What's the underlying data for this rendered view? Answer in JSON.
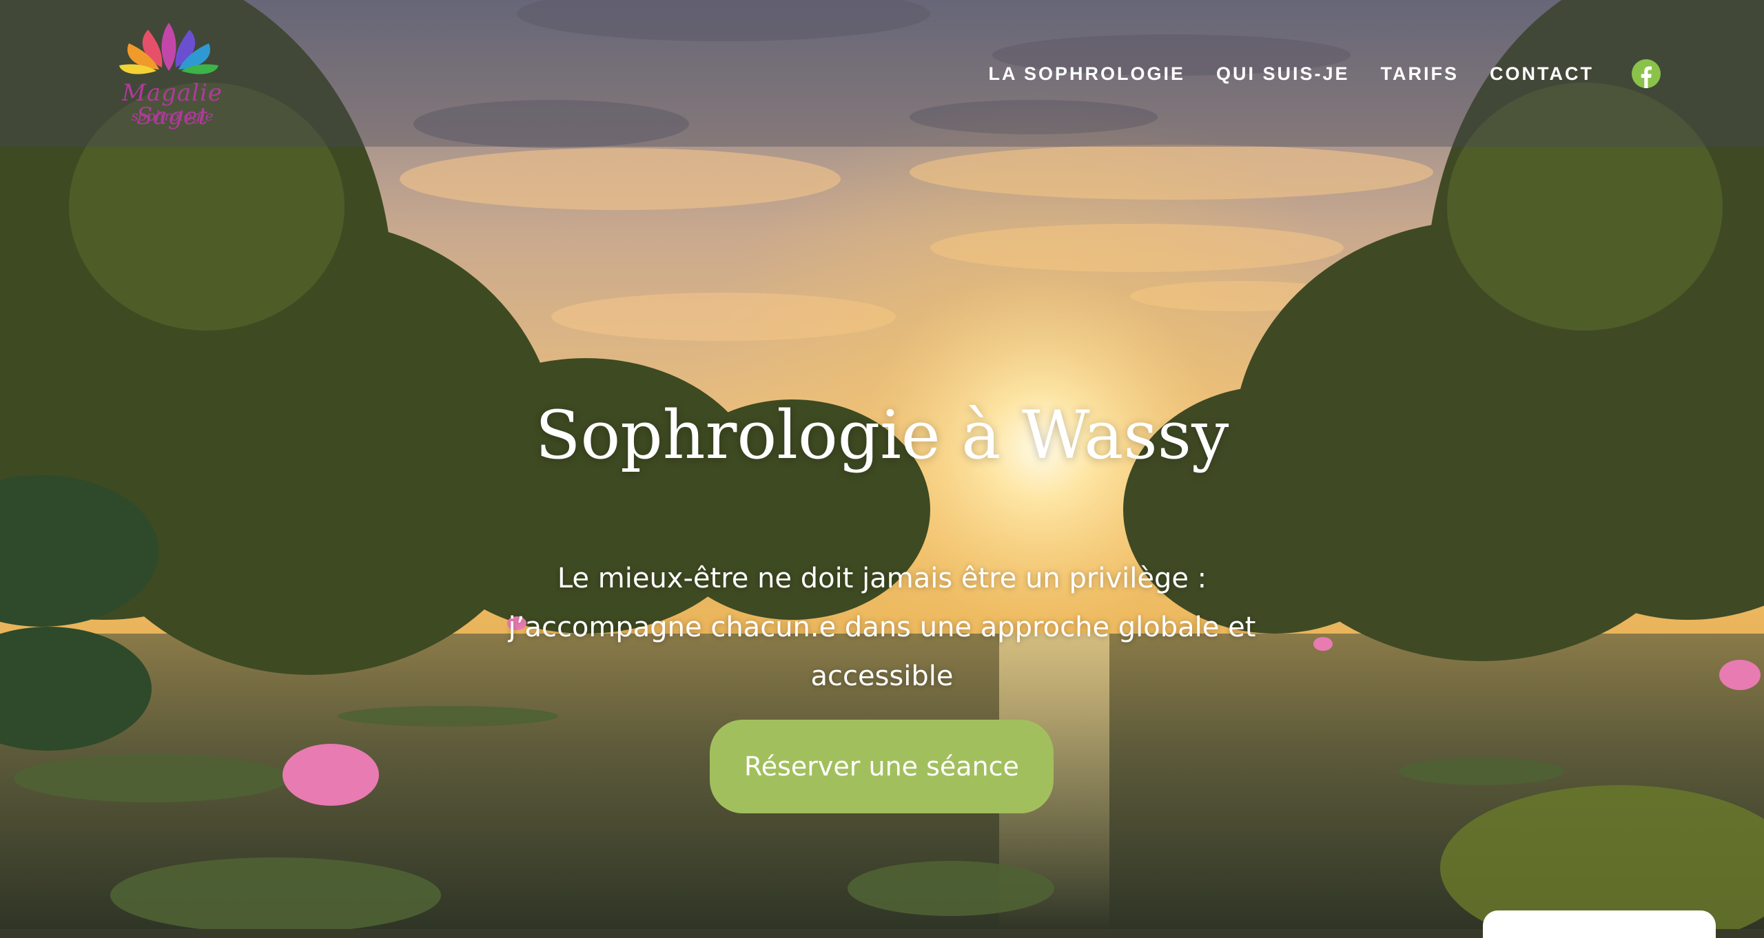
{
  "logo": {
    "name": "Magalie Saget",
    "tagline": "sophrologie"
  },
  "nav": {
    "items": [
      {
        "label": "LA SOPHROLOGIE"
      },
      {
        "label": "QUI SUIS-JE"
      },
      {
        "label": "TARIFS"
      },
      {
        "label": "CONTACT"
      }
    ],
    "social_icon": "facebook-icon"
  },
  "hero": {
    "title": "Sophrologie à Wassy",
    "subtitle": "Le mieux-être ne doit jamais être un privilège : j’accompagne chacun.e dans une approche globale et accessible",
    "cta_label": "Réserver une séance"
  },
  "colors": {
    "accent": "#a2bf5e",
    "facebook": "#8bc34a",
    "logo_text": "#b03a9c"
  }
}
